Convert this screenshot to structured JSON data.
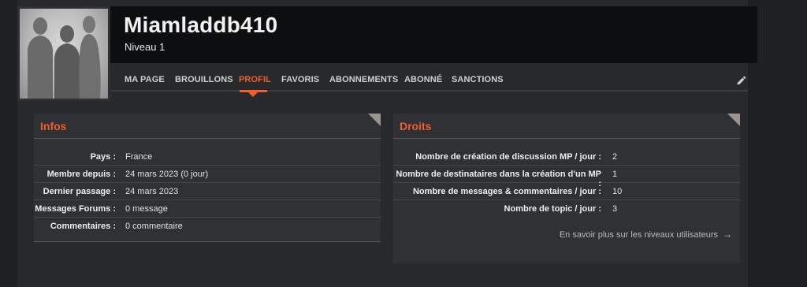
{
  "profile": {
    "username": "Miamladdb410",
    "level": "Niveau 1"
  },
  "tabs": [
    {
      "label": "MA PAGE"
    },
    {
      "label": "BROUILLONS"
    },
    {
      "label": "PROFIL",
      "active": true
    },
    {
      "label": "FAVORIS"
    },
    {
      "label": "ABONNEMENTS"
    },
    {
      "label": "ABONNÉ"
    },
    {
      "label": "SANCTIONS"
    }
  ],
  "infos": {
    "title": "Infos",
    "rows": [
      {
        "label": "Pays :",
        "value": "France"
      },
      {
        "label": "Membre depuis :",
        "value": "24 mars 2023 (0 jour)"
      },
      {
        "label": "Dernier passage :",
        "value": "24 mars 2023"
      },
      {
        "label": "Messages Forums :",
        "value": "0 message"
      },
      {
        "label": "Commentaires :",
        "value": "0 commentaire"
      }
    ]
  },
  "droits": {
    "title": "Droits",
    "rows": [
      {
        "label": "Nombre de création de discussion MP / jour :",
        "value": "2"
      },
      {
        "label": "Nombre de destinataires dans la création d'un MP :",
        "value": "1"
      },
      {
        "label": "Nombre de messages & commentaires / jour :",
        "value": "10"
      },
      {
        "label": "Nombre de topic / jour :",
        "value": "3"
      }
    ],
    "more_link": "En savoir plus sur les niveaux utilisateurs",
    "more_icon": "arrow-right-icon"
  },
  "colors": {
    "accent": "#f05d2f",
    "header_bg": "#0d0e10",
    "card_bg": "#2f3134",
    "page_bg": "#27292b"
  }
}
